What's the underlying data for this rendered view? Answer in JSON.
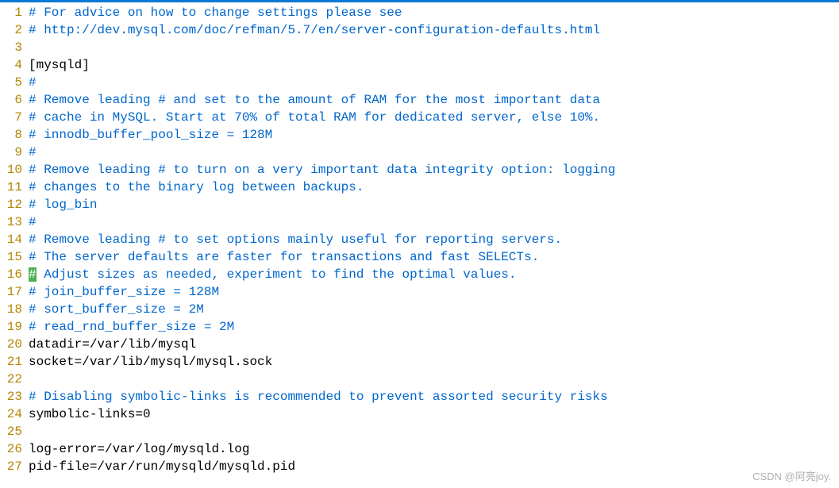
{
  "lines": [
    {
      "n": 1,
      "type": "comment",
      "text": "# For advice on how to change settings please see"
    },
    {
      "n": 2,
      "type": "comment",
      "text": "# http://dev.mysql.com/doc/refman/5.7/en/server-configuration-defaults.html"
    },
    {
      "n": 3,
      "type": "plain",
      "text": ""
    },
    {
      "n": 4,
      "type": "plain",
      "text": "[mysqld]"
    },
    {
      "n": 5,
      "type": "comment",
      "text": "#"
    },
    {
      "n": 6,
      "type": "comment",
      "text": "# Remove leading # and set to the amount of RAM for the most important data"
    },
    {
      "n": 7,
      "type": "comment",
      "text": "# cache in MySQL. Start at 70% of total RAM for dedicated server, else 10%."
    },
    {
      "n": 8,
      "type": "comment",
      "text": "# innodb_buffer_pool_size = 128M"
    },
    {
      "n": 9,
      "type": "comment",
      "text": "#"
    },
    {
      "n": 10,
      "type": "comment",
      "text": "# Remove leading # to turn on a very important data integrity option: logging"
    },
    {
      "n": 11,
      "type": "comment",
      "text": "# changes to the binary log between backups."
    },
    {
      "n": 12,
      "type": "comment",
      "text": "# log_bin"
    },
    {
      "n": 13,
      "type": "comment",
      "text": "#"
    },
    {
      "n": 14,
      "type": "comment",
      "text": "# Remove leading # to set options mainly useful for reporting servers."
    },
    {
      "n": 15,
      "type": "comment",
      "text": "# The server defaults are faster for transactions and fast SELECTs."
    },
    {
      "n": 16,
      "type": "comment-cursor",
      "first": "#",
      "rest": " Adjust sizes as needed, experiment to find the optimal values."
    },
    {
      "n": 17,
      "type": "comment",
      "text": "# join_buffer_size = 128M"
    },
    {
      "n": 18,
      "type": "comment",
      "text": "# sort_buffer_size = 2M"
    },
    {
      "n": 19,
      "type": "comment",
      "text": "# read_rnd_buffer_size = 2M"
    },
    {
      "n": 20,
      "type": "plain",
      "text": "datadir=/var/lib/mysql"
    },
    {
      "n": 21,
      "type": "plain",
      "text": "socket=/var/lib/mysql/mysql.sock"
    },
    {
      "n": 22,
      "type": "plain",
      "text": ""
    },
    {
      "n": 23,
      "type": "comment",
      "text": "# Disabling symbolic-links is recommended to prevent assorted security risks"
    },
    {
      "n": 24,
      "type": "plain",
      "text": "symbolic-links=0"
    },
    {
      "n": 25,
      "type": "plain",
      "text": ""
    },
    {
      "n": 26,
      "type": "plain",
      "text": "log-error=/var/log/mysqld.log"
    },
    {
      "n": 27,
      "type": "plain",
      "text": "pid-file=/var/run/mysqld/mysqld.pid"
    }
  ],
  "watermark": "CSDN @阿亮joy."
}
